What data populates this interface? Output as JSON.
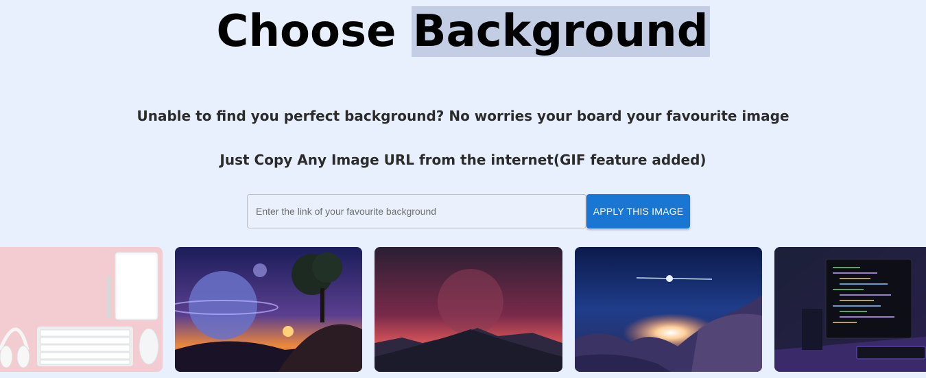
{
  "header": {
    "title_part1": "Choose",
    "title_part2": "Background"
  },
  "intro": {
    "line1": "Unable to find you perfect background? No worries your board your favourite image",
    "line2": "Just Copy Any Image URL from the internet(GIF feature added)"
  },
  "form": {
    "input_value": "",
    "input_placeholder": "Enter the link of your favourite background",
    "apply_label": "APPLY THIS IMAGE"
  },
  "backgrounds": [
    {
      "name": "desk-keyboard-headphones"
    },
    {
      "name": "planet-tree-sunset"
    },
    {
      "name": "mountain-moon-dusk"
    },
    {
      "name": "star-clouds-sky"
    },
    {
      "name": "code-monitor-setup"
    }
  ],
  "colors": {
    "page_background": "#e9f0fd",
    "accent": "#1976d2",
    "title_highlight": "#c3cde3"
  }
}
